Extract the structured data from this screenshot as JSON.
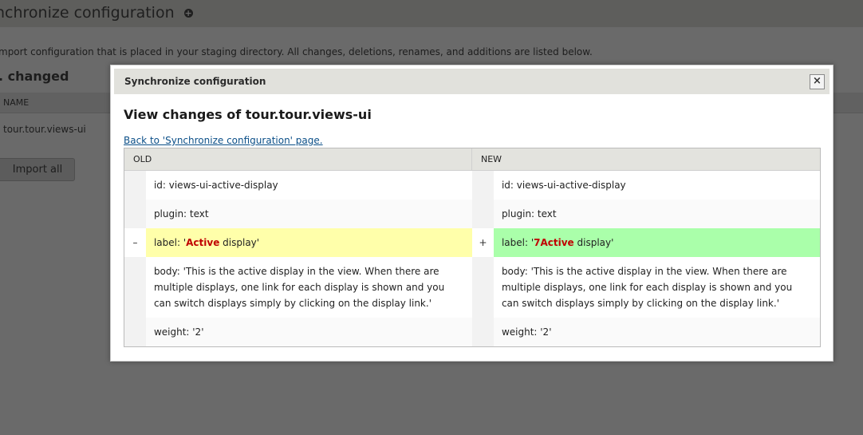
{
  "background": {
    "title": "nchronize configuration",
    "description": "mport configuration that is placed in your staging directory. All changes, deletions, renames, and additions are listed below.",
    "section": ". changed",
    "table_header": "NAME",
    "row": "tour.tour.views-ui",
    "import_button": "Import all"
  },
  "dialog": {
    "title": "Synchronize configuration",
    "close_label": "×",
    "heading": "View changes of tour.tour.views-ui",
    "back_link": "Back to 'Synchronize configuration' page.",
    "diff": {
      "old_header": "OLD",
      "new_header": "NEW",
      "rows": [
        {
          "marker_old": "",
          "marker_new": "",
          "old": "id: views-ui-active-display",
          "new": "id: views-ui-active-display"
        },
        {
          "marker_old": "",
          "marker_new": "",
          "old": "plugin: text",
          "new": "plugin: text"
        },
        {
          "marker_old": "–",
          "marker_new": "+",
          "old_prefix": "label: '",
          "old_highlight": "Active",
          "old_suffix": " display'",
          "new_prefix": "label: '",
          "new_highlight": "7Active",
          "new_suffix": " display'"
        },
        {
          "marker_old": "",
          "marker_new": "",
          "old": "body: 'This is the active display in the view. When there are multiple displays, one link for each display is shown and you can switch displays simply by clicking on the display link.'",
          "new": "body: 'This is the active display in the view. When there are multiple displays, one link for each display is shown and you can switch displays simply by clicking on the display link.'"
        },
        {
          "marker_old": "",
          "marker_new": "",
          "old": "weight: '2'",
          "new": "weight: '2'"
        }
      ]
    }
  },
  "colors": {
    "old_changed": "#ffffaa",
    "new_changed": "#aaffaa",
    "highlight": "#c00000",
    "link": "#0b4f88"
  }
}
